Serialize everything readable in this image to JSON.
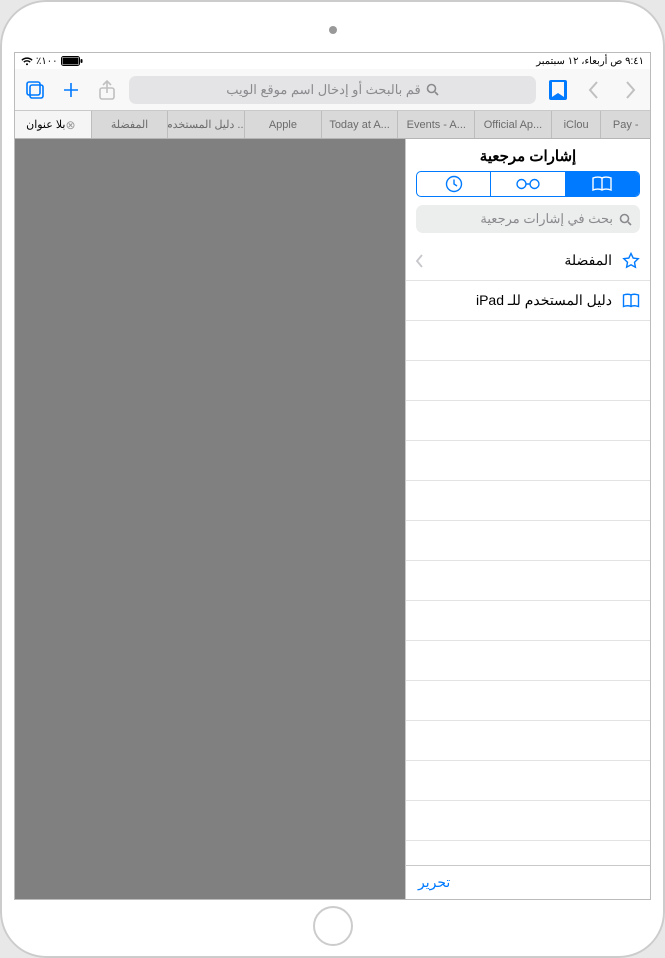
{
  "status": {
    "battery": "٪١٠٠",
    "datetime": "٩:٤١ ص  أربعاء، ١٢ سبتمبر"
  },
  "toolbar": {
    "url_placeholder": "قم بالبحث أو إدخال اسم موقع الويب"
  },
  "tabs": [
    {
      "label": "بلا عنوان",
      "active": true,
      "closable": true
    },
    {
      "label": "المفضلة"
    },
    {
      "label": "دليل المستخدم ..."
    },
    {
      "label": "Apple"
    },
    {
      "label": "Today at A..."
    },
    {
      "label": "Events - A..."
    },
    {
      "label": "Official Ap..."
    },
    {
      "label": "iClou"
    },
    {
      "label": "Pay -"
    }
  ],
  "sidebar": {
    "title": "إشارات مرجعية",
    "search_placeholder": "بحث في إشارات مرجعية",
    "items": [
      {
        "icon": "star",
        "label": "المفضلة",
        "has_children": true
      },
      {
        "icon": "book",
        "label": "دليل المستخدم للـ iPad",
        "has_children": false
      }
    ],
    "edit_label": "تحرير"
  }
}
